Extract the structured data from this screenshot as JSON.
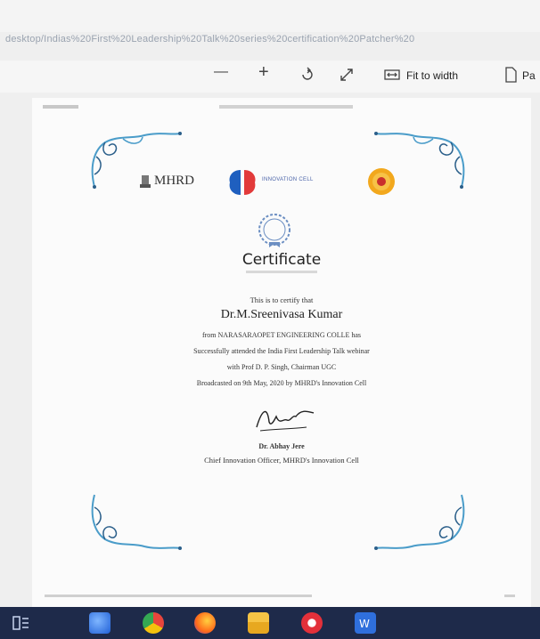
{
  "browser": {
    "url": "desktop/Indias%20First%20Leadership%20Talk%20series%20certification%20Patcher%20"
  },
  "toolbar": {
    "zoom_out_label": "—",
    "zoom_in_label": "+",
    "fit_to_width_label": "Fit to width",
    "page_view_label": "Pa"
  },
  "certificate": {
    "mhrd_label": "MHRD",
    "innovation_cell_label": "INNOVATION CELL",
    "heading": "Certificate",
    "line1": "This is to certify that",
    "name": "Dr.M.Sreenivasa Kumar",
    "line2": "from NARASARAOPET ENGINEERING COLLE has",
    "line3": "Successfully attended the India First Leadership Talk webinar",
    "line4": "with Prof D. P. Singh, Chairman UGC",
    "line5": "Broadcasted on 9th May, 2020 by MHRD's Innovation Cell",
    "signer_name": "Dr. Abhay Jere",
    "signer_title": "Chief Innovation Officer, MHRD's Innovation Cell"
  },
  "colors": {
    "ornament": "#4a9cc9",
    "ornament_dark": "#2b5f8a",
    "taskbar": "#1e2a4a"
  },
  "taskbar": {
    "icons": [
      "task-view-icon",
      "edge-icon",
      "chrome-icon",
      "firefox-icon",
      "file-explorer-icon",
      "app-icon",
      "word-icon"
    ]
  }
}
